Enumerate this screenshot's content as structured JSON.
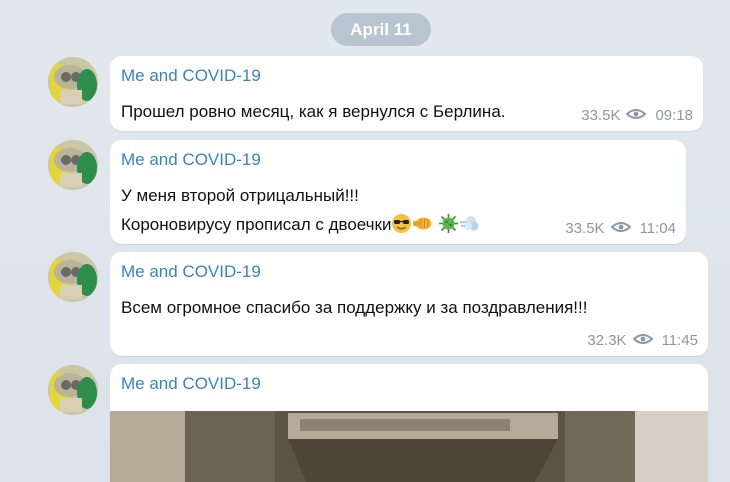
{
  "date_separator": "April 11",
  "channel_name": "Me and COVID-19",
  "messages": [
    {
      "sender": "Me and COVID-19",
      "lines": [
        "Прошел ровно месяц, как я вернулся с Берлина."
      ],
      "views": "33.5K",
      "time": "09:18"
    },
    {
      "sender": "Me and COVID-19",
      "lines": [
        "У меня второй отрицальный!!!",
        "Короновирусу прописал с двоечки"
      ],
      "emojis": [
        "sunglasses-emoji",
        "fist-emoji",
        "virus-emoji",
        "dash-emoji"
      ],
      "views": "33.5K",
      "time": "11:04"
    },
    {
      "sender": "Me and COVID-19",
      "lines": [
        "Всем огромное спасибо за поддержку и за поздравления!!!"
      ],
      "views": "32.3K",
      "time": "11:45"
    },
    {
      "sender": "Me and COVID-19",
      "media": "photo"
    }
  ],
  "colors": {
    "background": "#dfe5ec",
    "sender": "#3a82c4",
    "meta": "#8a97a5",
    "date_pill": "#b8c4cf"
  },
  "icons": [
    "eye-icon",
    "avatar"
  ]
}
